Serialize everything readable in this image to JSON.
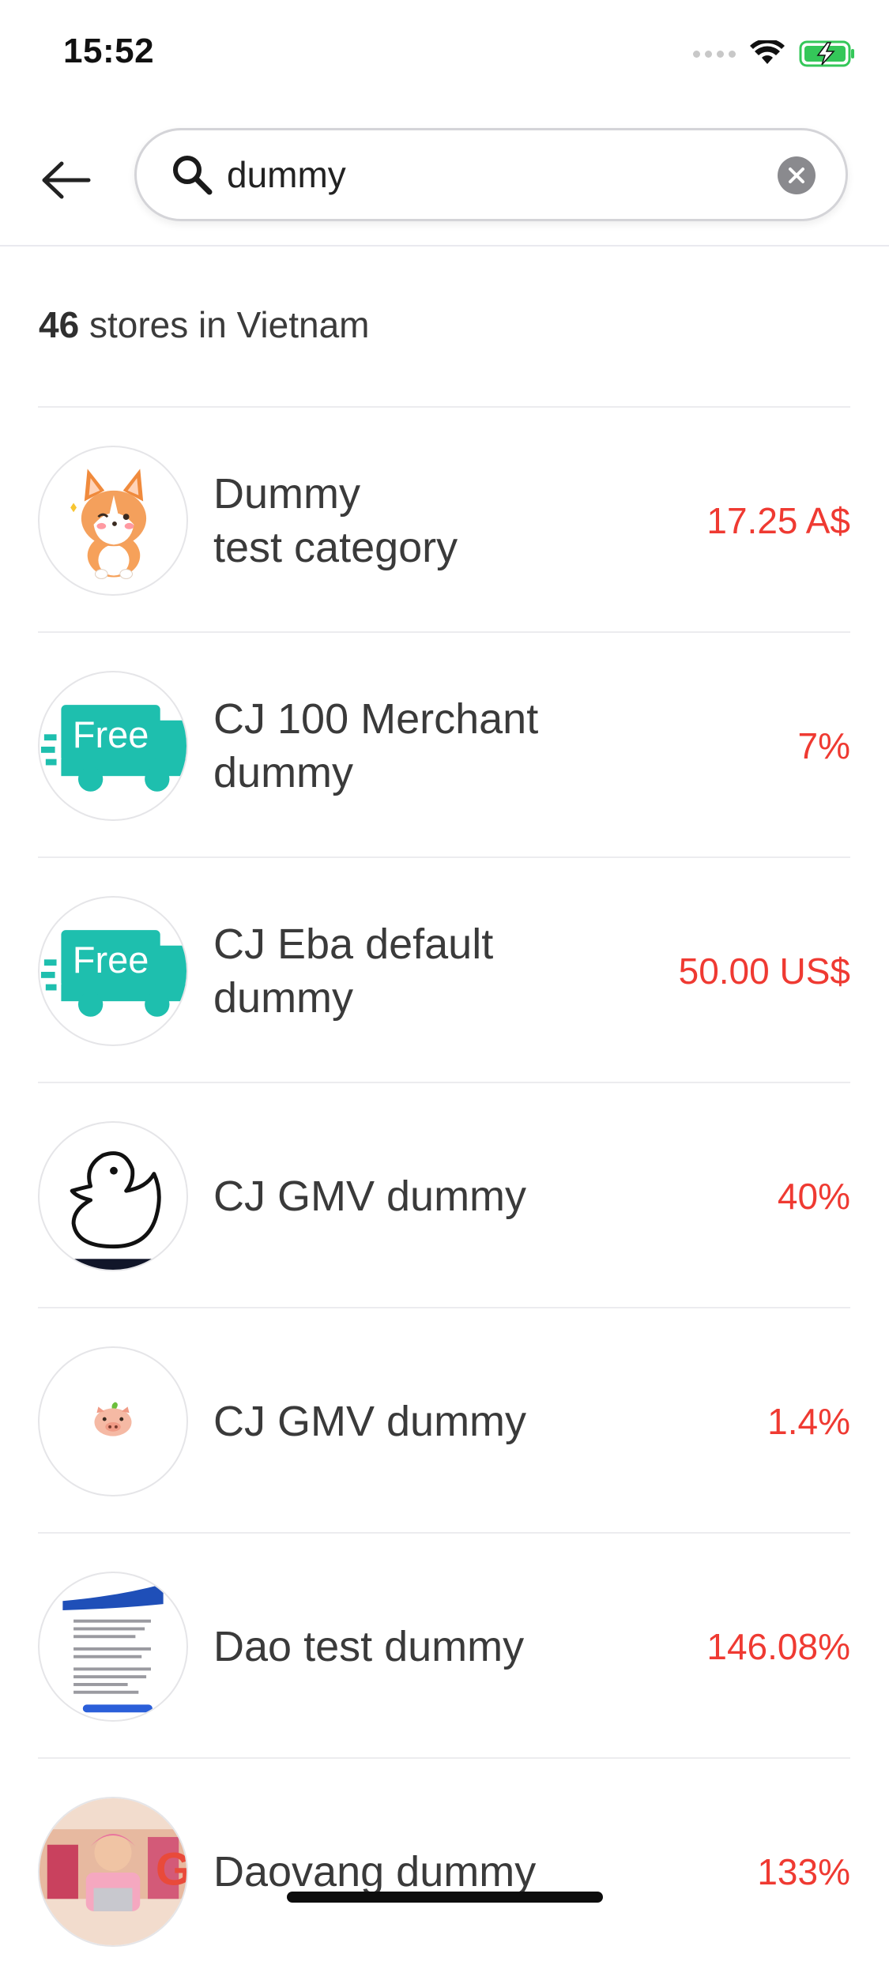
{
  "status_bar": {
    "time": "15:52",
    "signal_icon": "signal-dots-icon",
    "wifi_icon": "wifi-icon",
    "battery_icon": "battery-charging-icon",
    "battery_color": "#34c759"
  },
  "header": {
    "back_icon": "arrow-left-icon",
    "search": {
      "value": "dummy",
      "placeholder": "",
      "search_icon": "search-icon",
      "clear_icon": "clear-circle-icon"
    }
  },
  "results": {
    "count": "46",
    "suffix": " stores in Vietnam"
  },
  "stores": [
    {
      "name": "Dummy\ntest category",
      "cashback": "17.25 A$",
      "logo": "corgi-logo"
    },
    {
      "name": "CJ 100 Merchant\ndummy",
      "cashback": "7%",
      "logo": "free-truck-logo"
    },
    {
      "name": "CJ Eba default\ndummy",
      "cashback": "50.00 US$",
      "logo": "free-truck-logo"
    },
    {
      "name": "CJ GMV dummy",
      "cashback": "40%",
      "logo": "duck-logo"
    },
    {
      "name": "CJ GMV dummy",
      "cashback": "1.4%",
      "logo": "piglet-logo"
    },
    {
      "name": "Dao test dummy",
      "cashback": "146.08%",
      "logo": "document-screenshot-logo"
    },
    {
      "name": "Daovang dummy",
      "cashback": "133%",
      "logo": "shop-photo-logo"
    }
  ],
  "colors": {
    "cashback": "#ef3a32",
    "free_truck": "#1ebfae",
    "divider": "#ececef"
  }
}
